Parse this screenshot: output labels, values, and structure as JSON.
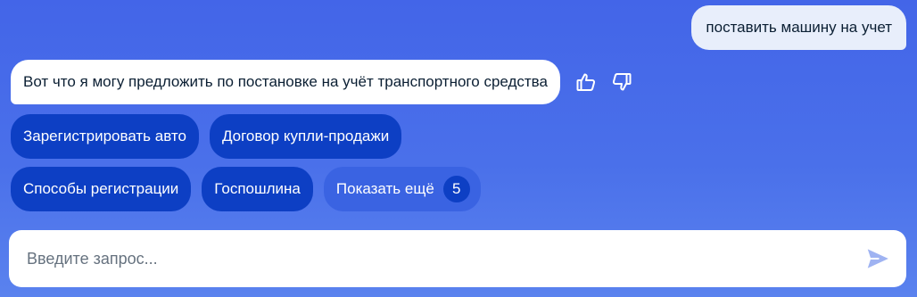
{
  "chat": {
    "user_message": "поставить машину на учет",
    "bot_message": "Вот что я могу предложить по постановке на учёт транспортного средства"
  },
  "feedback": {
    "like_icon": "thumbs-up-icon",
    "dislike_icon": "thumbs-down-icon"
  },
  "suggestions": {
    "row1": [
      "Зарегистрировать авто",
      "Договор купли-продажи"
    ],
    "row2": [
      "Способы регистрации",
      "Госпошлина"
    ],
    "more_label": "Показать ещё",
    "more_count": "5"
  },
  "input": {
    "placeholder": "Введите запрос...",
    "value": "",
    "send_icon": "send-icon"
  },
  "colors": {
    "background": "#4a6ee9",
    "chip": "#0d3fc4",
    "chip_more": "#3a63e2",
    "user_bubble": "#e8eefb",
    "send_icon": "#9fb3f2"
  }
}
